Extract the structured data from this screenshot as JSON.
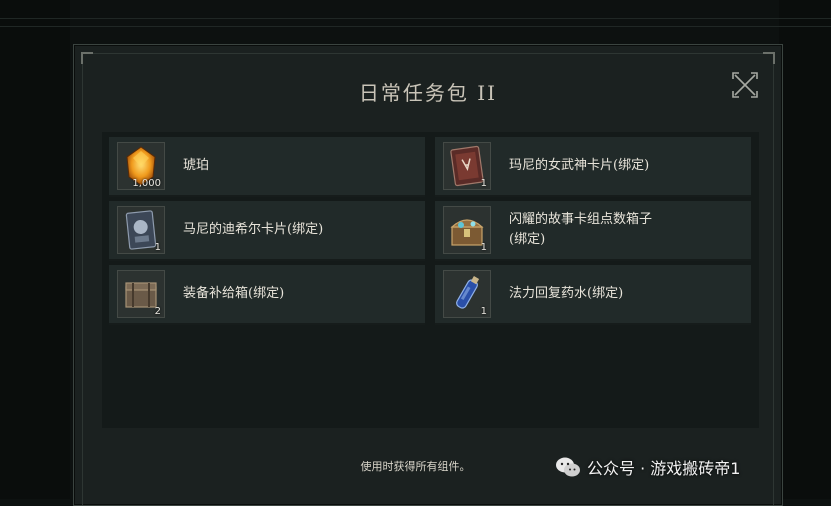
{
  "dialog": {
    "title": "日常任务包 II",
    "footer_note": "使用时获得所有组件。"
  },
  "items": [
    {
      "name": "琥珀",
      "quantity": "1,000",
      "icon": "amber-gem-icon"
    },
    {
      "name": "玛尼的女武神卡片(绑定)",
      "quantity": "1",
      "icon": "valkyrie-card-icon"
    },
    {
      "name": "马尼的迪希尔卡片(绑定)",
      "quantity": "1",
      "icon": "dihir-card-icon"
    },
    {
      "name": "闪耀的故事卡组点数箱子\n(绑定)",
      "quantity": "1",
      "icon": "story-deck-chest-icon"
    },
    {
      "name": "装备补给箱(绑定)",
      "quantity": "2",
      "icon": "supply-box-icon"
    },
    {
      "name": "法力回复药水(绑定)",
      "quantity": "1",
      "icon": "mana-potion-icon"
    }
  ],
  "watermark": {
    "text": "公众号 · 游戏搬砖帝1",
    "icon": "wechat-icon"
  },
  "colors": {
    "background": "#0d1110",
    "dialog": "#1b2120",
    "item": "#212a29",
    "text": "#e8e4da"
  }
}
